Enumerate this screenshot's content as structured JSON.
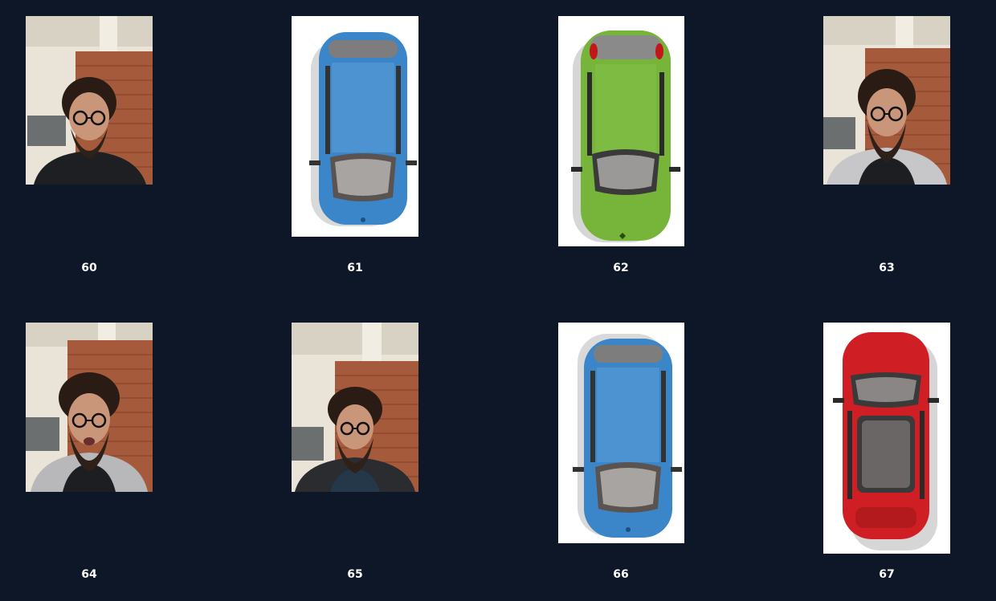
{
  "gallery": {
    "items": [
      {
        "number": "60",
        "kind": "selfie",
        "shirt": "black"
      },
      {
        "number": "61",
        "kind": "car",
        "color": "#3b86c8"
      },
      {
        "number": "62",
        "kind": "car",
        "color": "#76b43a"
      },
      {
        "number": "63",
        "kind": "selfie",
        "shirt": "hoodie"
      },
      {
        "number": "64",
        "kind": "selfie",
        "shirt": "hoodie"
      },
      {
        "number": "65",
        "kind": "selfie",
        "shirt": "hoodie"
      },
      {
        "number": "66",
        "kind": "car",
        "color": "#3b86c8"
      },
      {
        "number": "67",
        "kind": "car",
        "color": "#d01f24"
      }
    ]
  }
}
